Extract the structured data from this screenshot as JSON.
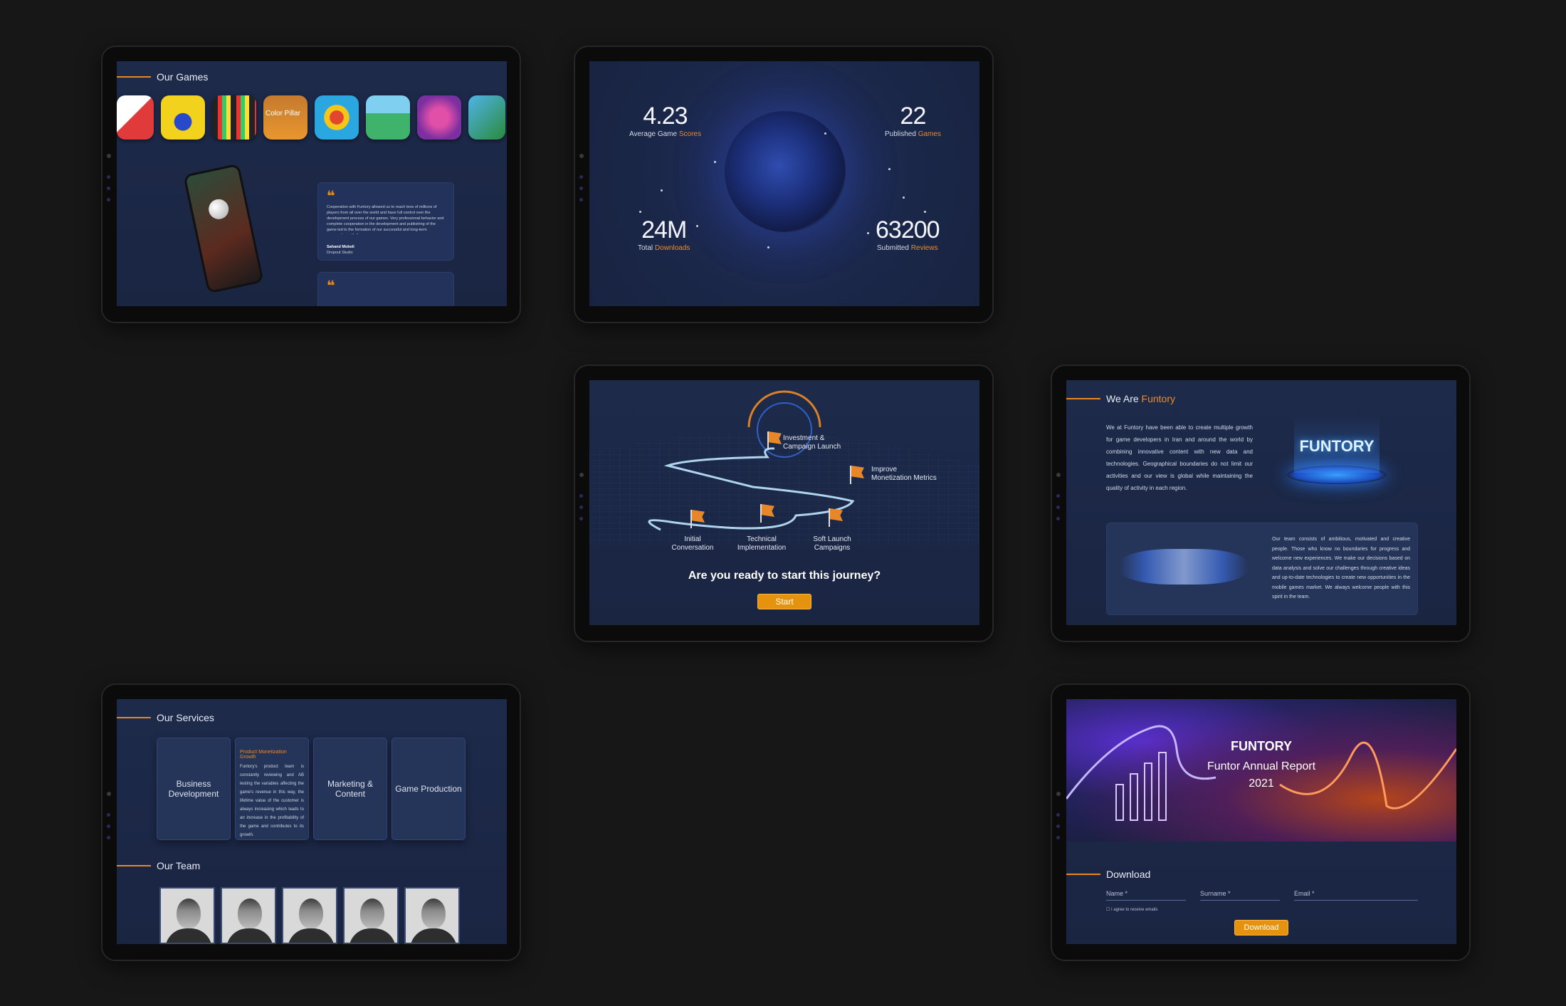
{
  "games": {
    "title": "Our Games",
    "featured_app_caption": "Color Pillar",
    "quote": {
      "text": "Cooperation with Funtory allowed us to reach tens of millions of players from all over the world and have full control over the development process of our games. Very professional behavior and complete cooperation in the development and publishing of the game led to the formation of our successful and long-term cooperation with them.",
      "author": "Sahand Mobeli",
      "company": "Dropout Studio"
    }
  },
  "stats": {
    "scores": {
      "value": "4.23",
      "label": "Average Game ",
      "accent": "Scores"
    },
    "games": {
      "value": "22",
      "label": "Published ",
      "accent": "Games"
    },
    "downloads": {
      "value": "24M",
      "label": "Total ",
      "accent": "Downloads"
    },
    "reviews": {
      "value": "63200",
      "label": "Submitted ",
      "accent": "Reviews"
    }
  },
  "journey": {
    "steps": [
      {
        "label": "Initial Conversation"
      },
      {
        "label": "Technical Implementation"
      },
      {
        "label": "Soft Launch Campaigns"
      },
      {
        "label": "Improve Monetization Metrics"
      },
      {
        "label": "Investment & Campaign Launch"
      }
    ],
    "question": "Are you ready to start this journey?",
    "start_label": "Start"
  },
  "about": {
    "title": "We Are ",
    "title_accent": "Funtory",
    "logo_text": "FUNTORY",
    "paragraph1": "We at Funtory have been able to create multiple growth for game developers in Iran and around the world by combining innovative content with new data and technologies. Geographical boundaries do not limit our activities and our view is global while maintaining the quality of activity in each region.",
    "paragraph2": "Our team consists of ambitious, motivated and creative people. Those who know no boundaries for progress and welcome new experiences. We make our decisions based on data analysis and solve our challenges through creative ideas and up-to-date technologies to create new opportunities in the mobile games market. We always welcome people with this spirit in the team."
  },
  "services": {
    "title": "Our Services",
    "items": [
      {
        "label": "Business Development"
      },
      {
        "label": "Product Monetization Growth",
        "detail": "Funtory's product team is constantly reviewing and AB testing the variables affecting the game's revenue in this way, the lifetime value of the customer is always increasing which leads to an increase in the profitability of the game and contributes to its growth."
      },
      {
        "label": "Marketing & Content"
      },
      {
        "label": "Game Production"
      }
    ],
    "team_title": "Our Team"
  },
  "report": {
    "logo_text": "FUNTORY",
    "title": "Funtor Annual Report",
    "year": "2021",
    "download_title": "Download",
    "name_placeholder": "Name *",
    "surname_placeholder": "Surname *",
    "email_placeholder": "Email *",
    "consent": "I agree to receive emails",
    "download_label": "Download"
  },
  "colors": {
    "accent": "#f08a24",
    "background": "#171717",
    "screen": "#1d2a4a"
  }
}
